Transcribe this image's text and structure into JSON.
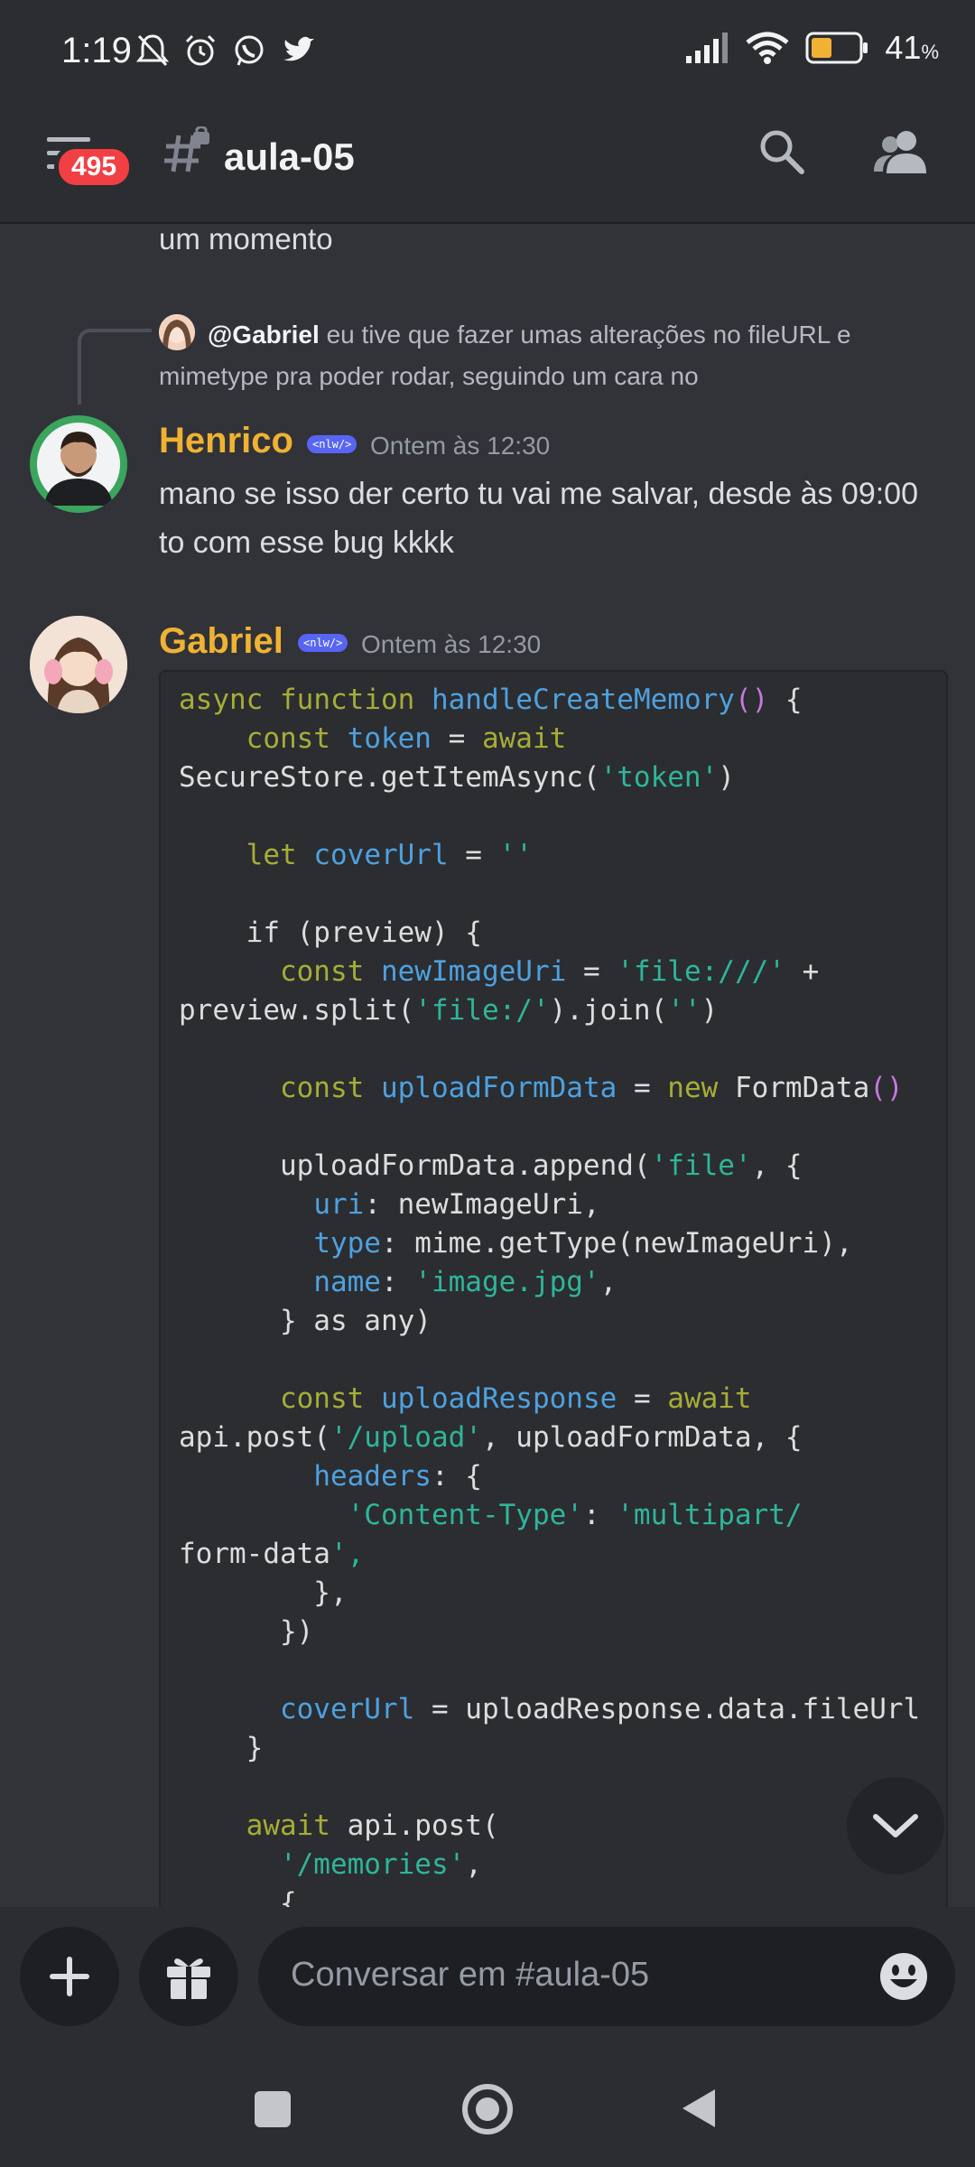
{
  "status_bar": {
    "time": "1:19",
    "battery": "41",
    "battery_unit": "%"
  },
  "header": {
    "badge_count": "495",
    "channel_name": "aula-05"
  },
  "messages": {
    "continuation_text": "um momento",
    "reply": {
      "username": "@Gabriel",
      "text": "eu tive que fazer umas alterações no fileURL e mimetype pra poder rodar, seguindo um cara no"
    },
    "henrico": {
      "username": "Henrico",
      "tag": "<nlw/>",
      "timestamp": "Ontem às 12:30",
      "text": "mano se isso der certo tu vai me salvar, desde às 09:00 to com esse bug kkkk"
    },
    "gabriel": {
      "username": "Gabriel",
      "tag": "<nlw/>",
      "timestamp": "Ontem às 12:30",
      "code_lines": [
        "async function handleCreateMemory() {",
        "    const token = await",
        "SecureStore.getItemAsync('token')",
        "",
        "    let coverUrl = ''",
        "",
        "    if (preview) {",
        "      const newImageUri = 'file:///' +",
        "preview.split('file:/').join('')",
        "",
        "      const uploadFormData = new FormData()",
        "",
        "      uploadFormData.append('file', {",
        "        uri: newImageUri,",
        "        type: mime.getType(newImageUri),",
        "        name: 'image.jpg',",
        "      } as any)",
        "",
        "      const uploadResponse = await",
        "api.post('/upload', uploadFormData, {",
        "        headers: {",
        "          'Content-Type': 'multipart/",
        "form-data',",
        "        },",
        "      })",
        "",
        "      coverUrl = uploadResponse.data.fileUrl",
        "    }",
        "",
        "    await api.post(",
        "      '/memories',",
        "      {"
      ]
    }
  },
  "composer": {
    "placeholder": "Conversar em #aula-05"
  },
  "icons": [
    "mute-icon",
    "alarm-icon",
    "whatsapp-icon",
    "twitter-icon",
    "signal-icon",
    "wifi-icon",
    "battery-icon",
    "hamburger-icon",
    "locked-channel-icon",
    "search-icon",
    "members-icon",
    "chevron-down-icon",
    "plus-icon",
    "gift-icon",
    "emoji-icon",
    "nav-square-icon",
    "nav-home-icon",
    "nav-back-icon"
  ],
  "colors": {
    "username": "#f0b232",
    "tag": "#5865f2",
    "badge": "#f23f43",
    "background": "#313338"
  }
}
